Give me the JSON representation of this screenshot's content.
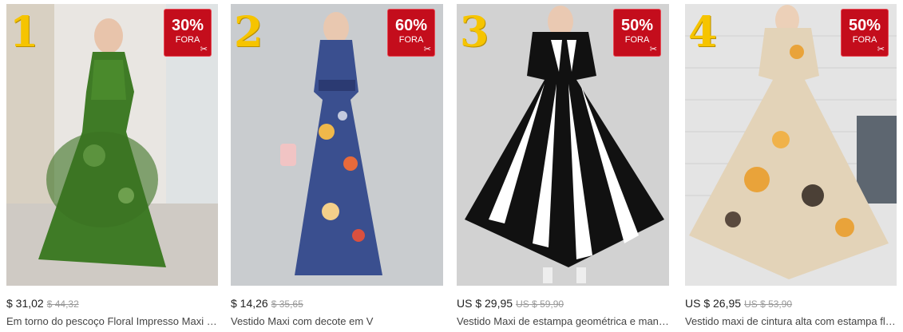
{
  "products": [
    {
      "rank": "1",
      "discount_pct": "30%",
      "discount_label": "FORA",
      "price": "$ 31,02",
      "old_price": "$ 44,32",
      "title": "Em torno do pescoço Floral Impresso Maxi Vestido",
      "photo_desc": "green floral maxi dress"
    },
    {
      "rank": "2",
      "discount_pct": "60%",
      "discount_label": "FORA",
      "price": "$ 14,26",
      "old_price": "$ 35,65",
      "title": "Vestido Maxi com decote em V",
      "photo_desc": "blue floral sleeveless maxi dress"
    },
    {
      "rank": "3",
      "discount_pct": "50%",
      "discount_label": "FORA",
      "price": "US $ 29,95",
      "old_price": "US $ 59,90",
      "title": "Vestido Maxi de estampa geométrica e manga curta",
      "photo_desc": "black and white striped maxi dress"
    },
    {
      "rank": "4",
      "discount_pct": "50%",
      "discount_label": "FORA",
      "price": "US $ 26,95",
      "old_price": "US $ 53,90",
      "title": "Vestido maxi de cintura alta com estampa floral",
      "photo_desc": "beige floral chiffon maxi dress"
    }
  ],
  "colors": {
    "badge": "#c40d1c",
    "rank": "#f6c400"
  },
  "icons": {
    "badge_mark": "scissors-icon"
  }
}
